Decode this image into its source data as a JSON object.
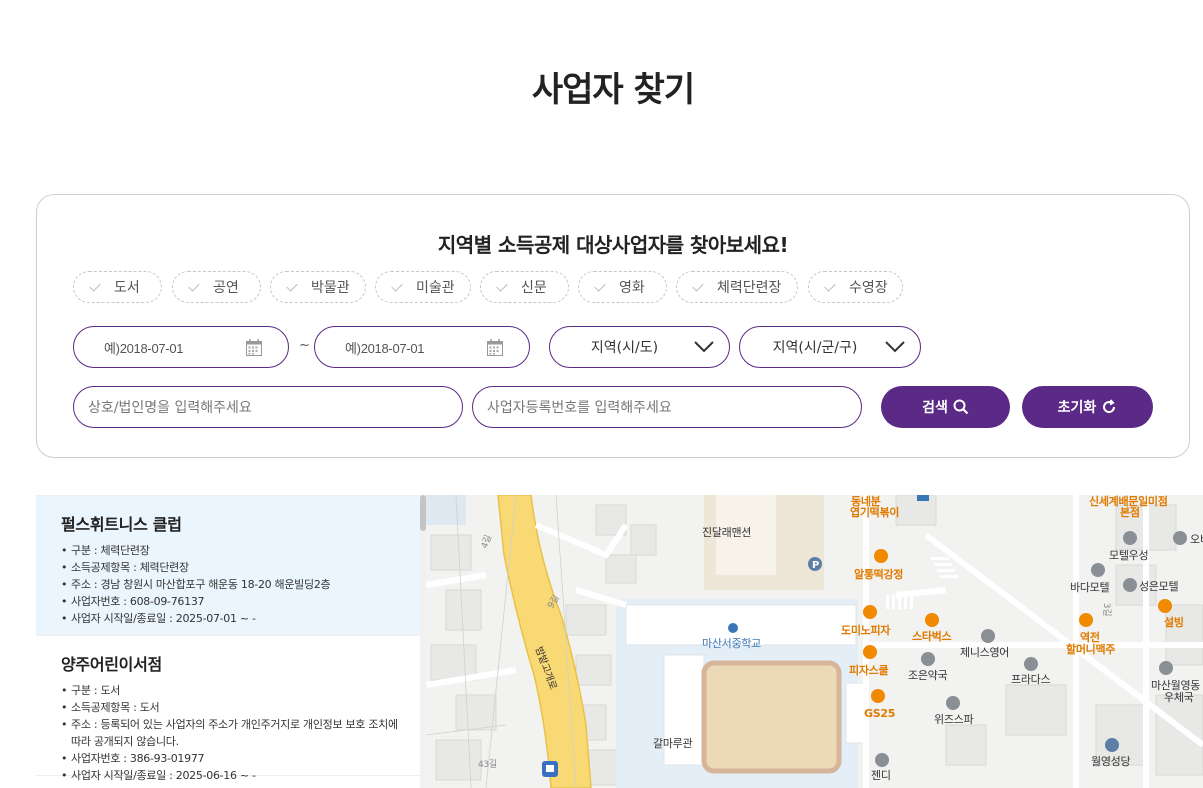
{
  "page": {
    "title": "사업자 찾기"
  },
  "search": {
    "subtitle": "지역별 소득공제 대상사업자를 찾아보세요!",
    "categories": [
      "도서",
      "공연",
      "박물관",
      "미술관",
      "신문",
      "영화",
      "체력단련장",
      "수영장"
    ],
    "date_start_placeholder": "예)2018-07-01",
    "date_end_placeholder": "예)2018-07-01",
    "date_separator": "~",
    "region_sido": "지역(시/도)",
    "region_sigungu": "지역(시/군/구)",
    "name_placeholder": "상호/법인명을 입력해주세요",
    "bizno_placeholder": "사업자등록번호를 입력해주세요",
    "search_label": "검색",
    "reset_label": "초기화"
  },
  "colors": {
    "accent": "#5a2a86",
    "active_row": "#eaf5fd",
    "map_road": "#f9d973",
    "map_poi": "#e07a00"
  },
  "results": [
    {
      "name": "펄스휘트니스 클럽",
      "lines": [
        "구분 : 체력단련장",
        "소득공제항목 : 체력단련장",
        "주소 : 경남 창원시 마산합포구 해운동 18-20 해운빌딩2층",
        "사업자번호 : 608-09-76137",
        "사업자 시작일/종료일 : 2025-07-01 ~ -"
      ]
    },
    {
      "name": "양주어린이서점",
      "lines": [
        "구분 : 도서",
        "소득공제항목 : 도서",
        "주소 : 등록되어 있는 사업자의 주소가 개인주거지로 개인정보 보호 조치에 따라 공개되지 않습니다.",
        "사업자번호 : 386-93-01977",
        "사업자 시작일/종료일 : 2025-06-16 ~ -"
      ]
    }
  ],
  "map": {
    "labels": {
      "school": "마산서중학교",
      "apartment": "진달래맨션",
      "building": "갈마루관",
      "road": "밤밭고개로",
      "alley": "9길",
      "alley2": "4길",
      "alley3": "43길",
      "alley4": "3길",
      "tteok": "알통떡강정",
      "domino": "도미노피자",
      "pizzaschool": "피자스쿨",
      "gs25": "GS25",
      "starbucks": "스타벅스",
      "tennis": "제니스영어",
      "pharmacy": "조은약국",
      "prada": "프라다스",
      "wizpa": "위즈스파",
      "gendy": "젠디",
      "dongnae_a": "동네분",
      "dongnae_b": "엽기떡볶이",
      "shinsegae_a": "신세계배문일미점",
      "shinsegae_b": "본점",
      "motel_woosung": "모텔우성",
      "bada_motel": "바다모텔",
      "seongeun_motel": "성은모텔",
      "obi": "오비",
      "seolbing": "설빙",
      "yeokjeon_a": "역전",
      "yeokjeon_b": "할머니맥주",
      "masan_post_a": "마산월영동",
      "masan_post_b": "우체국",
      "wolyoung_church": "월영성당"
    }
  }
}
